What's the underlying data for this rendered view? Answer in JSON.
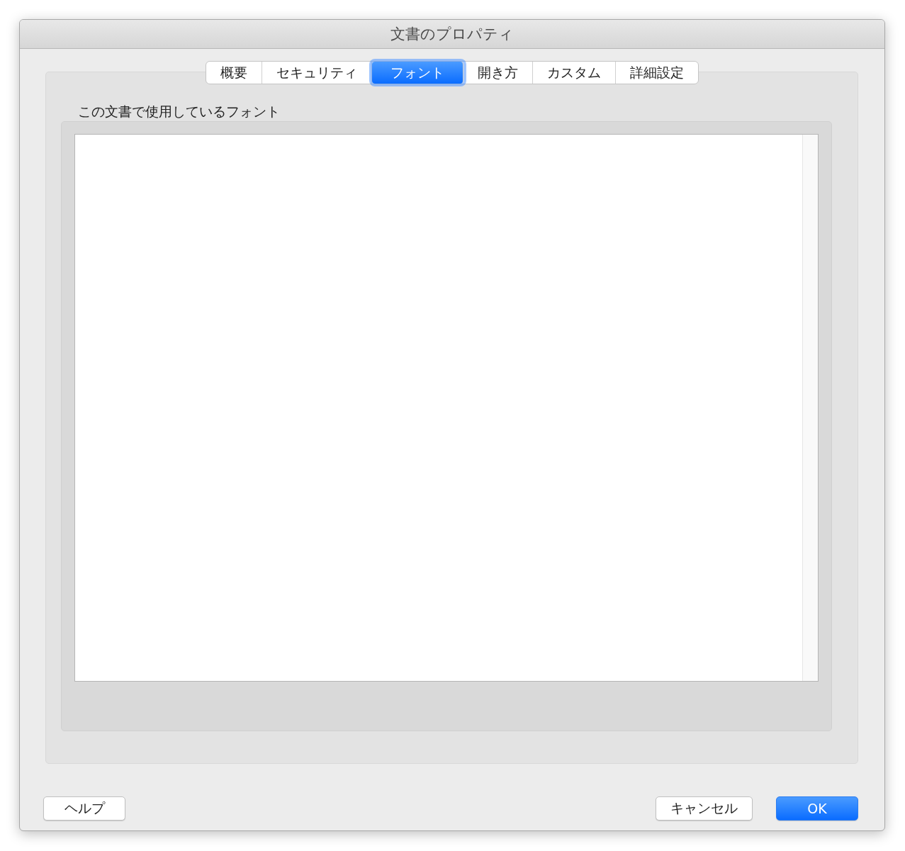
{
  "window": {
    "title": "文書のプロパティ"
  },
  "tabs": [
    {
      "label": "概要",
      "selected": false
    },
    {
      "label": "セキュリティ",
      "selected": false
    },
    {
      "label": "フォント",
      "selected": true
    },
    {
      "label": "開き方",
      "selected": false
    },
    {
      "label": "カスタム",
      "selected": false
    },
    {
      "label": "詳細設定",
      "selected": false
    }
  ],
  "fonts_section": {
    "label": "この文書で使用しているフォント"
  },
  "help_button": {
    "label": "ヘルプ"
  },
  "buttons": [
    {
      "label": "キャンセル",
      "default": false
    },
    {
      "label": "OK",
      "default": true
    }
  ]
}
